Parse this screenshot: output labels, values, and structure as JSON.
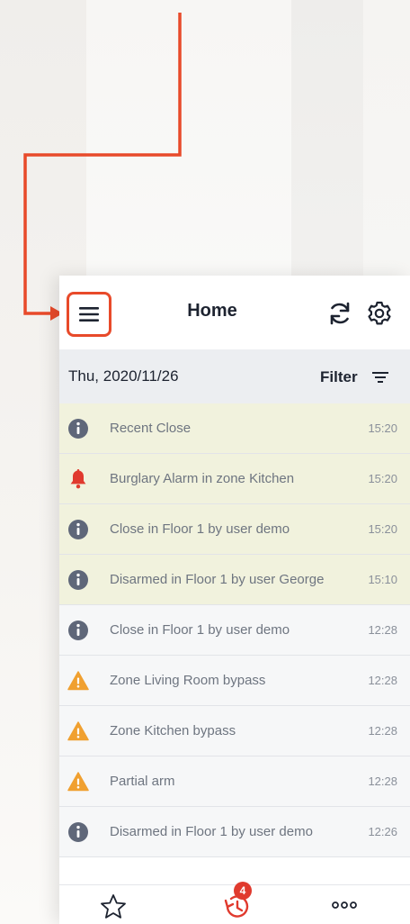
{
  "header": {
    "title": "Home",
    "menu_icon": "hamburger-menu-icon",
    "refresh_icon": "refresh-icon",
    "settings_icon": "gear-icon"
  },
  "datebar": {
    "date": "Thu, 2020/11/26",
    "filter_label": "Filter",
    "filter_icon": "filter-icon"
  },
  "events": [
    {
      "icon": "info-icon",
      "message": "Recent Close",
      "time": "15:20",
      "highlighted": true
    },
    {
      "icon": "alarm-bell-icon",
      "message": "Burglary Alarm in zone Kitchen",
      "time": "15:20",
      "highlighted": true
    },
    {
      "icon": "info-icon",
      "message": "Close in Floor 1 by user demo",
      "time": "15:20",
      "highlighted": true
    },
    {
      "icon": "info-icon",
      "message": "Disarmed in Floor 1 by user George",
      "time": "15:10",
      "highlighted": true
    },
    {
      "icon": "info-icon",
      "message": "Close in Floor 1 by user demo",
      "time": "12:28",
      "highlighted": false
    },
    {
      "icon": "warning-icon",
      "message": "Zone Living Room bypass",
      "time": "12:28",
      "highlighted": false
    },
    {
      "icon": "warning-icon",
      "message": "Zone Kitchen bypass",
      "time": "12:28",
      "highlighted": false
    },
    {
      "icon": "warning-icon",
      "message": "Partial arm",
      "time": "12:28",
      "highlighted": false
    },
    {
      "icon": "info-icon",
      "message": "Disarmed in Floor 1 by user demo",
      "time": "12:26",
      "highlighted": false
    }
  ],
  "bottom_nav": {
    "favorites_icon": "star-icon",
    "history_icon": "history-icon",
    "history_badge": "4",
    "more_icon": "more-icon"
  },
  "colors": {
    "callout": "#e84a2a",
    "highlight_row": "#f1f2dd",
    "info": "#5f6779",
    "alarm": "#e03a2e",
    "warning": "#f0a030",
    "badge": "#e03a2e"
  }
}
